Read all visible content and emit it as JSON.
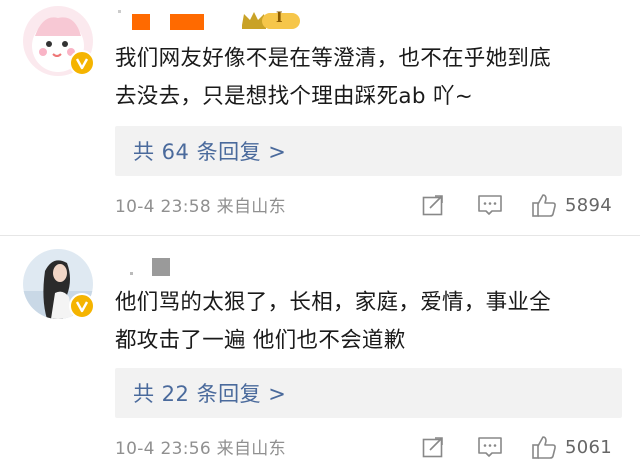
{
  "comments": [
    {
      "text": "我们网友好像不是在等澄清，也不在乎她到底\n去没去，只是想找个理由踩死ab 吖~",
      "replies_label": "共 64 条回复 >",
      "timestamp": "10-4 23:58 来自山东",
      "likes": "5894",
      "verified": true,
      "level_badge": "I"
    },
    {
      "text": "他们骂的太狠了，长相，家庭，爱情，事业全\n都攻击了一遍 他们也不会道歉",
      "replies_label": "共 22 条回复 >",
      "timestamp": "10-4 23:56 来自山东",
      "likes": "5061",
      "verified": true
    }
  ],
  "icons": {
    "share": "share-icon",
    "comment": "comment-icon",
    "like": "thumbs-up-icon",
    "verified": "verified-v-icon"
  },
  "colors": {
    "reply_link": "#4a6a9c",
    "meta_text": "#909090",
    "reply_box_bg": "#f2f2f2",
    "verified_badge": "#f5b400",
    "redacted_orange": "#ff6a00"
  }
}
